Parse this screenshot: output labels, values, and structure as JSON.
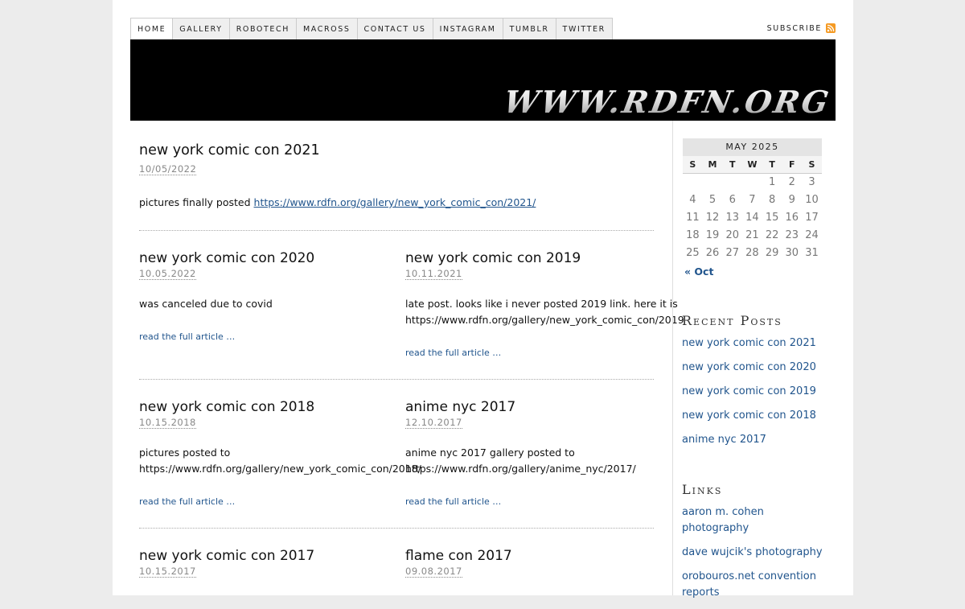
{
  "nav": {
    "items": [
      "HOME",
      "GALLERY",
      "ROBOTECH",
      "MACROSS",
      "CONTACT US",
      "INSTAGRAM",
      "TUMBLR",
      "TWITTER"
    ],
    "subscribe": "SUBSCRIBE"
  },
  "banner": {
    "text": "WWW.RDFN.ORG"
  },
  "featured": {
    "title": "new york comic con 2021",
    "date": "10/05/2022",
    "text": "pictures finally posted ",
    "link": "https://www.rdfn.org/gallery/new_york_comic_con/2021/"
  },
  "read_more": "read the full article …",
  "posts": [
    {
      "title": "new york comic con 2020",
      "date": "10.05.2022",
      "lines": [
        "was canceled due to covid"
      ]
    },
    {
      "title": "new york comic con 2019",
      "date": "10.11.2021",
      "lines": [
        "late post. looks like i never posted 2019 link. here it is",
        "https://www.rdfn.org/gallery/new_york_comic_con/2019"
      ]
    },
    {
      "title": "new york comic con 2018",
      "date": "10.15.2018",
      "lines": [
        "pictures posted to",
        "https://www.rdfn.org/gallery/new_york_comic_con/2018/"
      ]
    },
    {
      "title": "anime nyc 2017",
      "date": "12.10.2017",
      "lines": [
        "anime nyc 2017 gallery posted to",
        "https://www.rdfn.org/gallery/anime_nyc/2017/"
      ]
    },
    {
      "title": "new york comic con 2017",
      "date": "10.15.2017",
      "lines": []
    },
    {
      "title": "flame con 2017",
      "date": "09.08.2017",
      "lines": []
    }
  ],
  "calendar": {
    "caption": "MAY 2025",
    "days": [
      "S",
      "M",
      "T",
      "W",
      "T",
      "F",
      "S"
    ],
    "weeks": [
      [
        "",
        "",
        "",
        "",
        "1",
        "2",
        "3"
      ],
      [
        "4",
        "5",
        "6",
        "7",
        "8",
        "9",
        "10"
      ],
      [
        "11",
        "12",
        "13",
        "14",
        "15",
        "16",
        "17"
      ],
      [
        "18",
        "19",
        "20",
        "21",
        "22",
        "23",
        "24"
      ],
      [
        "25",
        "26",
        "27",
        "28",
        "29",
        "30",
        "31"
      ]
    ],
    "prev": "« Oct"
  },
  "recent_posts": {
    "heading": "Recent Posts",
    "items": [
      "new york comic con 2021",
      "new york comic con 2020",
      "new york comic con 2019",
      "new york comic con 2018",
      "anime nyc 2017"
    ]
  },
  "links": {
    "heading": "Links",
    "items": [
      "aaron m. cohen photography",
      "dave wujcik's photography",
      "orobouros.net convention reports"
    ]
  },
  "colors": {
    "link": "#21558d",
    "rss": "#f59a23"
  }
}
